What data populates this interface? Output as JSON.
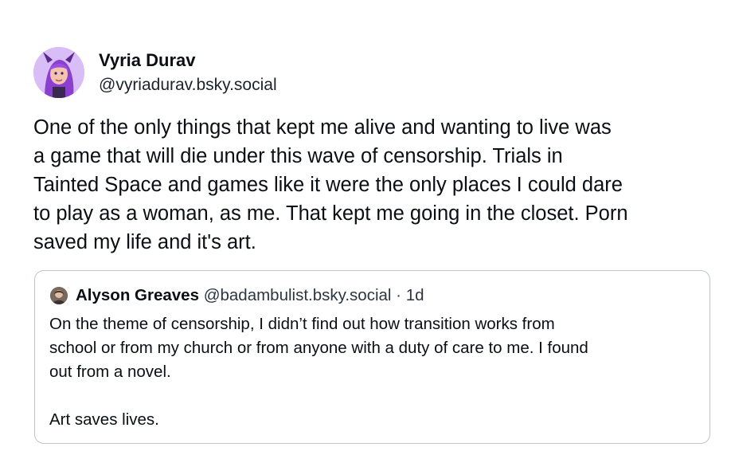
{
  "post": {
    "author": {
      "display_name": "Vyria Durav",
      "handle": "@vyriadurav.bsky.social"
    },
    "text_lines": [
      "One of the only things that kept me alive and wanting to live was",
      "a game that will die under this wave of censorship. Trials in",
      "Tainted Space and games like it were the only places I could dare",
      "to play as a woman, as me. That kept me going in the closet. Porn",
      "saved my life and it's art."
    ]
  },
  "quote": {
    "author": {
      "display_name": "Alyson Greaves",
      "handle": "@badambulist.bsky.social",
      "separator": " · ",
      "time": "1d"
    },
    "text_lines": [
      "On the theme of censorship, I didn’t find out how transition works from",
      "school or from my church or from anyone with a duty of care to me. I found",
      "out from a novel.",
      "",
      "Art saves lives."
    ]
  }
}
